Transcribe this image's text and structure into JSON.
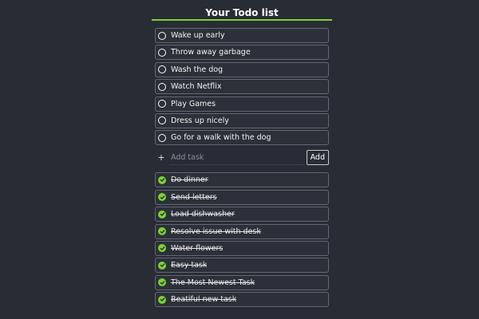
{
  "app": {
    "title": "Your Todo list",
    "accent_color": "#7cd232"
  },
  "pending_tasks": [
    {
      "label": "Wake up early",
      "done": false
    },
    {
      "label": "Throw away garbage",
      "done": false
    },
    {
      "label": "Wash the dog",
      "done": false
    },
    {
      "label": "Watch Netflix",
      "done": false
    },
    {
      "label": "Play Games",
      "done": false
    },
    {
      "label": "Dress up nicely",
      "done": false
    },
    {
      "label": "Go for a walk with the dog",
      "done": false
    }
  ],
  "add_task": {
    "icon": "plus-icon",
    "icon_glyph": "+",
    "placeholder": "Add task",
    "value": "",
    "button_label": "Add"
  },
  "completed_tasks": [
    {
      "label": "Do dinner",
      "done": true
    },
    {
      "label": "Send letters",
      "done": true
    },
    {
      "label": "Load dishwasher",
      "done": true
    },
    {
      "label": "Resolve issue with desk",
      "done": true
    },
    {
      "label": "Water flowers",
      "done": true
    },
    {
      "label": "Easy task",
      "done": true
    },
    {
      "label": "The Most Newest Task",
      "done": true
    },
    {
      "label": "Beatiful new task",
      "done": true
    }
  ]
}
